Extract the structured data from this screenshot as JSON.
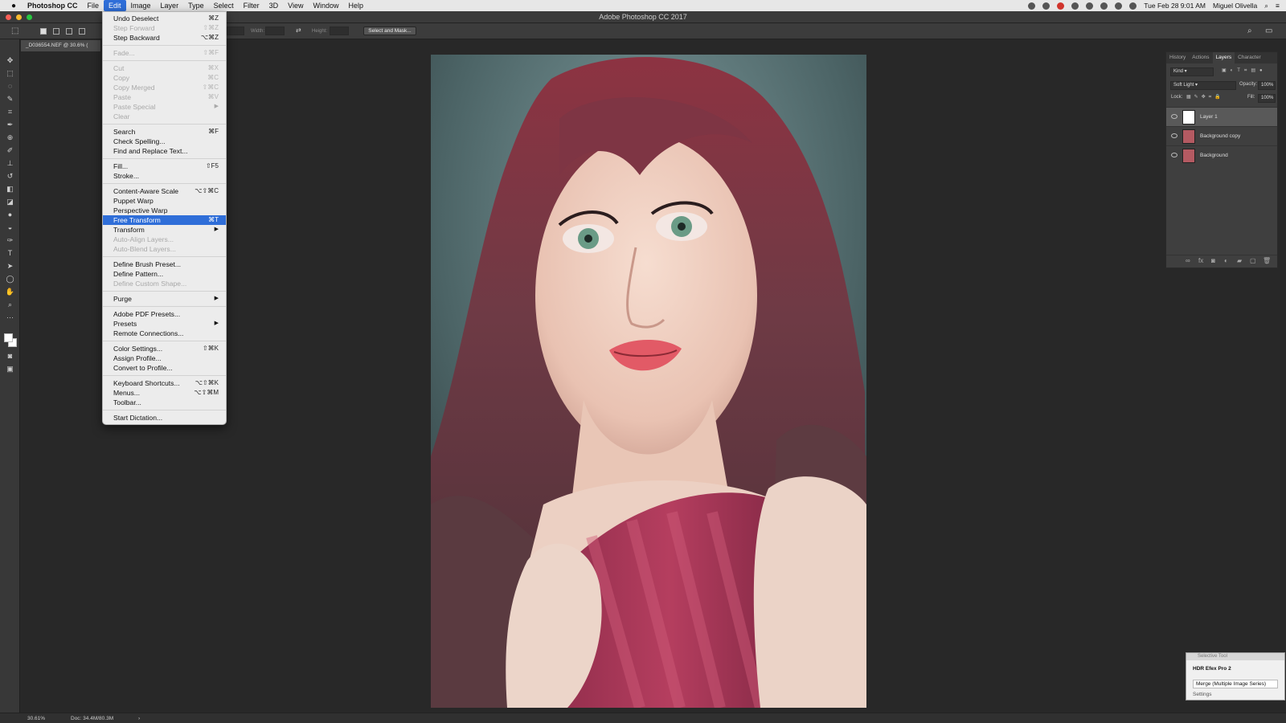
{
  "menubar": {
    "app_name": "Photoshop CC",
    "items": [
      "File",
      "Edit",
      "Image",
      "Layer",
      "Type",
      "Select",
      "Filter",
      "3D",
      "View",
      "Window",
      "Help"
    ],
    "active_item": "Edit",
    "clock": "Tue Feb 28  9:01 AM",
    "user": "Miguel Olivella"
  },
  "window": {
    "title": "Adobe Photoshop CC 2017"
  },
  "options_bar": {
    "width_label": "Width:",
    "height_label": "Height:",
    "select_mask_button": "Select and Mask..."
  },
  "document": {
    "tab_label": "_D036554.NEF @ 30.6% (",
    "zoom": "30.61%",
    "doc_size": "Doc: 34.4M/80.3M"
  },
  "edit_menu": {
    "groups": [
      [
        {
          "label": "Undo Deselect",
          "shortcut": "⌘Z",
          "enabled": true
        },
        {
          "label": "Step Forward",
          "shortcut": "⇧⌘Z",
          "enabled": false
        },
        {
          "label": "Step Backward",
          "shortcut": "⌥⌘Z",
          "enabled": true
        }
      ],
      [
        {
          "label": "Fade...",
          "shortcut": "⇧⌘F",
          "enabled": false
        }
      ],
      [
        {
          "label": "Cut",
          "shortcut": "⌘X",
          "enabled": false
        },
        {
          "label": "Copy",
          "shortcut": "⌘C",
          "enabled": false
        },
        {
          "label": "Copy Merged",
          "shortcut": "⇧⌘C",
          "enabled": false
        },
        {
          "label": "Paste",
          "shortcut": "⌘V",
          "enabled": false
        },
        {
          "label": "Paste Special",
          "shortcut": "",
          "enabled": false,
          "submenu": true
        },
        {
          "label": "Clear",
          "shortcut": "",
          "enabled": false
        }
      ],
      [
        {
          "label": "Search",
          "shortcut": "⌘F",
          "enabled": true
        },
        {
          "label": "Check Spelling...",
          "shortcut": "",
          "enabled": true
        },
        {
          "label": "Find and Replace Text...",
          "shortcut": "",
          "enabled": true
        }
      ],
      [
        {
          "label": "Fill...",
          "shortcut": "⇧F5",
          "enabled": true
        },
        {
          "label": "Stroke...",
          "shortcut": "",
          "enabled": true
        }
      ],
      [
        {
          "label": "Content-Aware Scale",
          "shortcut": "⌥⇧⌘C",
          "enabled": true
        },
        {
          "label": "Puppet Warp",
          "shortcut": "",
          "enabled": true
        },
        {
          "label": "Perspective Warp",
          "shortcut": "",
          "enabled": true
        },
        {
          "label": "Free Transform",
          "shortcut": "⌘T",
          "enabled": true,
          "highlighted": true
        },
        {
          "label": "Transform",
          "shortcut": "",
          "enabled": true,
          "submenu": true
        },
        {
          "label": "Auto-Align Layers...",
          "shortcut": "",
          "enabled": false
        },
        {
          "label": "Auto-Blend Layers...",
          "shortcut": "",
          "enabled": false
        }
      ],
      [
        {
          "label": "Define Brush Preset...",
          "shortcut": "",
          "enabled": true
        },
        {
          "label": "Define Pattern...",
          "shortcut": "",
          "enabled": true
        },
        {
          "label": "Define Custom Shape...",
          "shortcut": "",
          "enabled": false
        }
      ],
      [
        {
          "label": "Purge",
          "shortcut": "",
          "enabled": true,
          "submenu": true
        }
      ],
      [
        {
          "label": "Adobe PDF Presets...",
          "shortcut": "",
          "enabled": true
        },
        {
          "label": "Presets",
          "shortcut": "",
          "enabled": true,
          "submenu": true
        },
        {
          "label": "Remote Connections...",
          "shortcut": "",
          "enabled": true
        }
      ],
      [
        {
          "label": "Color Settings...",
          "shortcut": "⇧⌘K",
          "enabled": true
        },
        {
          "label": "Assign Profile...",
          "shortcut": "",
          "enabled": true
        },
        {
          "label": "Convert to Profile...",
          "shortcut": "",
          "enabled": true
        }
      ],
      [
        {
          "label": "Keyboard Shortcuts...",
          "shortcut": "⌥⇧⌘K",
          "enabled": true
        },
        {
          "label": "Menus...",
          "shortcut": "⌥⇧⌘M",
          "enabled": true
        },
        {
          "label": "Toolbar...",
          "shortcut": "",
          "enabled": true
        }
      ],
      [
        {
          "label": "Start Dictation...",
          "shortcut": "",
          "enabled": true
        }
      ]
    ]
  },
  "layers_panel": {
    "tabs": [
      "History",
      "Actions",
      "Layers",
      "Character"
    ],
    "active_tab": "Layers",
    "kind_filter": "Kind",
    "blend_mode": "Soft Light",
    "opacity_label": "Opacity:",
    "opacity": "100%",
    "lock_label": "Lock:",
    "fill_label": "Fill:",
    "fill": "100%",
    "layers": [
      {
        "name": "Layer 1",
        "selected": true
      },
      {
        "name": "Background copy",
        "selected": false
      },
      {
        "name": "Background",
        "selected": false
      }
    ]
  },
  "nik_panel": {
    "title": "Selective Tool",
    "header": "HDR Efex Pro 2",
    "merge_button": "Merge (Multiple Image Series)",
    "settings": "Settings"
  },
  "colors": {
    "menu_highlight": "#2f6ed8",
    "foreground_swatch": "#ffffff",
    "background_swatch": "#ffffff"
  }
}
